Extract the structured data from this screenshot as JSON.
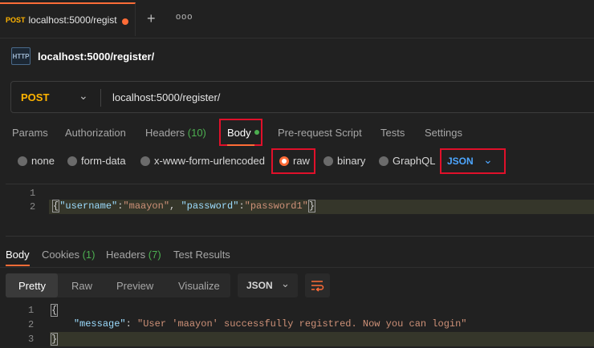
{
  "tab": {
    "method": "POST",
    "title": "localhost:5000/regist"
  },
  "request": {
    "name": "localhost:5000/register/",
    "method": "POST",
    "url": "localhost:5000/register/"
  },
  "request_tabs": {
    "params": "Params",
    "authorization": "Authorization",
    "headers": "Headers",
    "headers_count": "(10)",
    "body": "Body",
    "pre_request": "Pre-request Script",
    "tests": "Tests",
    "settings": "Settings"
  },
  "body_modes": {
    "none": "none",
    "form_data": "form-data",
    "urlencoded": "x-www-form-urlencoded",
    "raw": "raw",
    "binary": "binary",
    "graphql": "GraphQL",
    "format": "JSON"
  },
  "request_body": {
    "line_numbers": [
      "1",
      "2"
    ],
    "open_brace": "{",
    "k1": "\"username\"",
    "colon": ":",
    "v1": "\"maayon\"",
    "comma": ", ",
    "k2": "\"password\"",
    "v2": "\"password1\"",
    "close_brace": "}"
  },
  "response_tabs": {
    "body": "Body",
    "cookies": "Cookies",
    "cookies_count": "(1)",
    "headers": "Headers",
    "headers_count": "(7)",
    "test_results": "Test Results"
  },
  "response_view": {
    "pretty": "Pretty",
    "raw": "Raw",
    "preview": "Preview",
    "visualize": "Visualize",
    "format": "JSON"
  },
  "response_body": {
    "line_numbers": [
      "1",
      "2",
      "3"
    ],
    "open_brace": "{",
    "key": "\"message\"",
    "colon": ": ",
    "value": "\"User 'maayon' successfully registred. Now you can login\"",
    "close_brace": "}"
  },
  "colors": {
    "accent": "#ff6c37",
    "method": "#ffb400",
    "highlight_box": "#e0102a",
    "success": "#4caf50",
    "link": "#4da6ff"
  }
}
